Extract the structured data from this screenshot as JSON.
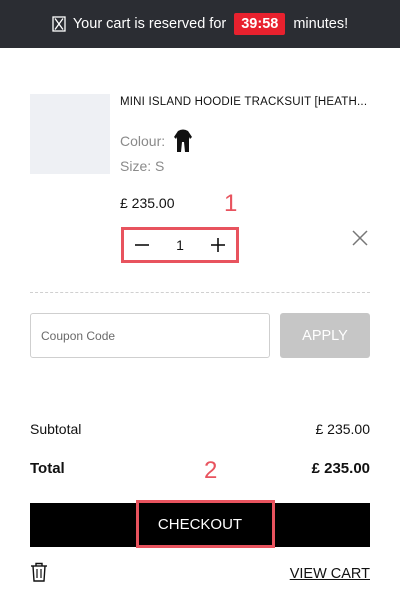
{
  "banner": {
    "prefix": "Your cart is reserved for",
    "timer": "39:58",
    "suffix": "minutes!",
    "timer_color": "#e8212e"
  },
  "item": {
    "name": "MINI ISLAND HOODIE TRACKSUIT [HEATH...",
    "colour_label": "Colour:",
    "size_label": "Size: S",
    "price": "£ 235.00",
    "quantity": "1"
  },
  "annotations": {
    "one": "1",
    "two": "2",
    "color": "#e8535e"
  },
  "coupon": {
    "placeholder": "Coupon Code",
    "value": "",
    "apply_label": "APPLY"
  },
  "summary": {
    "subtotal_label": "Subtotal",
    "subtotal_value": "£ 235.00",
    "total_label": "Total",
    "total_value": "£ 235.00"
  },
  "actions": {
    "checkout_label": "CHECKOUT",
    "view_cart_label": "VIEW CART"
  },
  "icons": [
    "hourglass-icon",
    "minus-icon",
    "plus-icon",
    "close-icon",
    "trash-icon"
  ]
}
